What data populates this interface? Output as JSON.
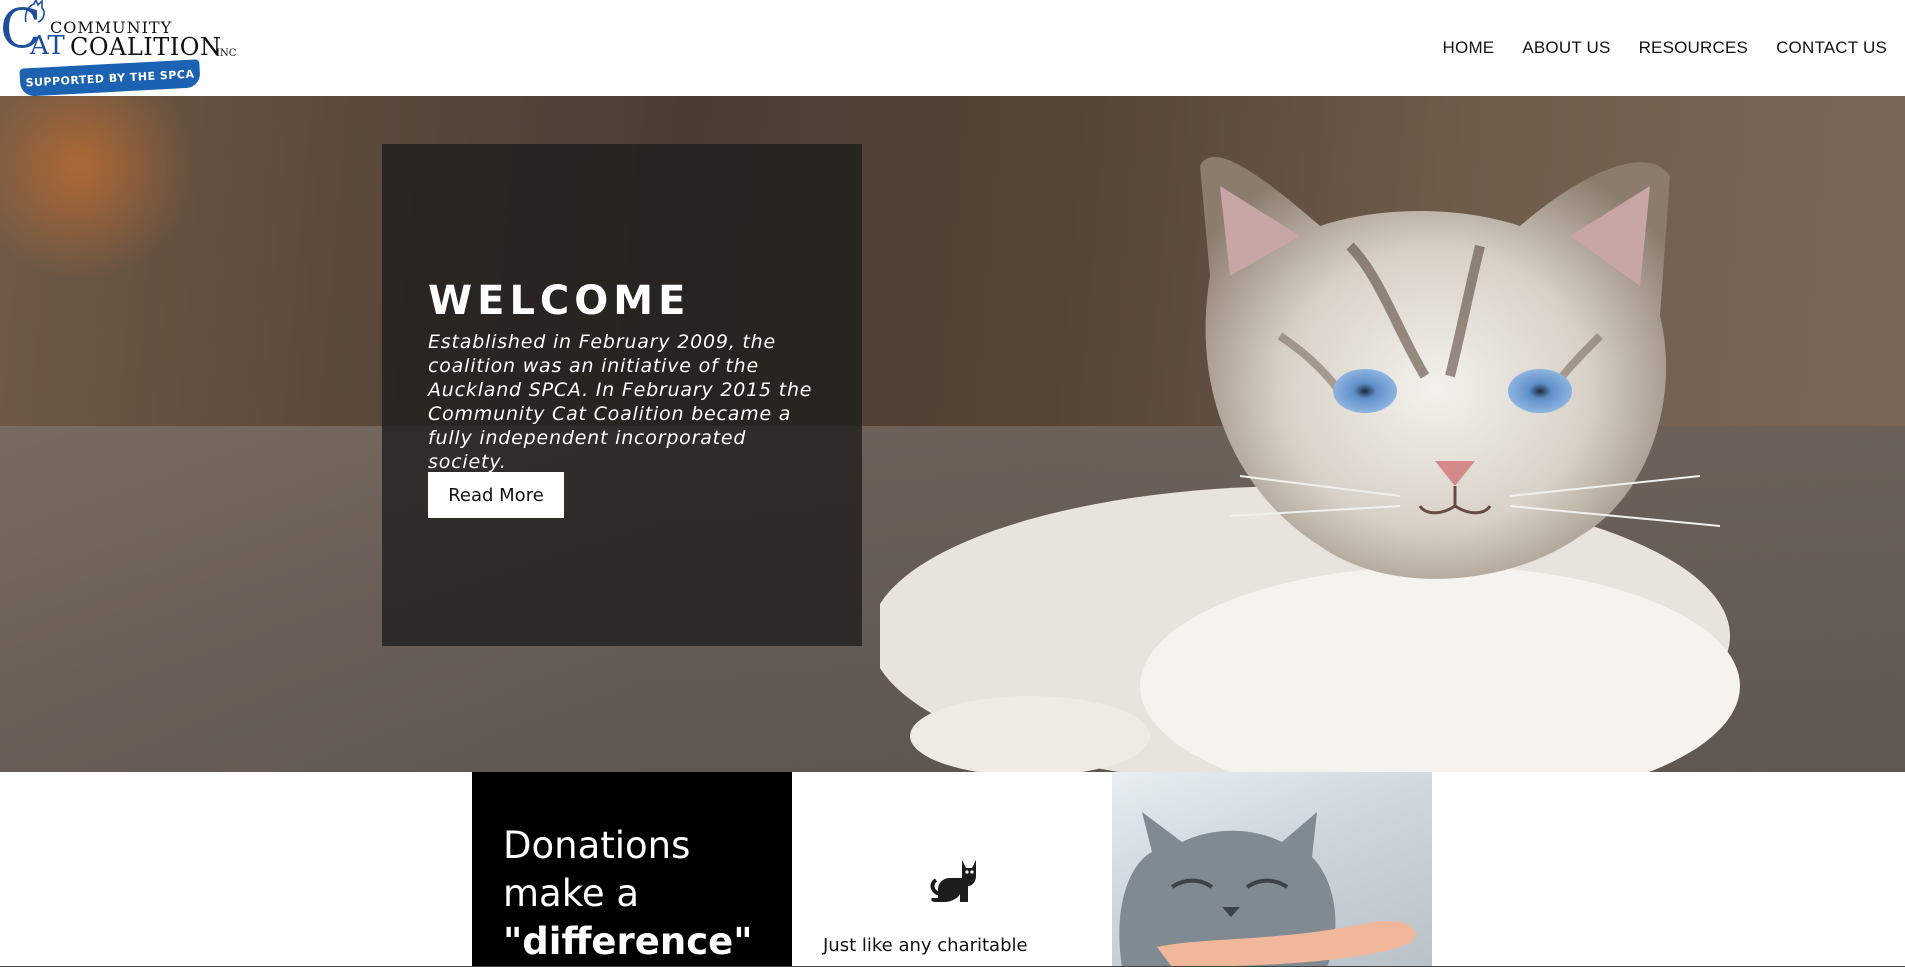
{
  "logo": {
    "community": "COMMUNITY",
    "letter_c": "C",
    "letters_at": "AT",
    "coalition": "COALITION",
    "inc": "INC",
    "ribbon": "SUPPORTED BY THE SPCA"
  },
  "nav": {
    "items": [
      {
        "label": "HOME"
      },
      {
        "label": "ABOUT US"
      },
      {
        "label": "RESOURCES"
      },
      {
        "label": "CONTACT US"
      }
    ]
  },
  "hero": {
    "title": "WELCOME",
    "text": "Established in February 2009, the coalition was an initiative of the Auckland SPCA. In February 2015 the Community Cat Coalition became a fully independent incorporated society.",
    "button": "Read More"
  },
  "strip": {
    "donate": {
      "line1": "Donations",
      "line2": "make a",
      "line3": "\"difference\""
    },
    "info": {
      "icon": "cat-sitting-icon",
      "text": "Just like any charitable"
    }
  },
  "colors": {
    "brand_blue": "#1e4e9c",
    "ribbon_blue": "#1b62b3",
    "overlay": "#1e1c1b",
    "donate_bg": "#000000"
  }
}
